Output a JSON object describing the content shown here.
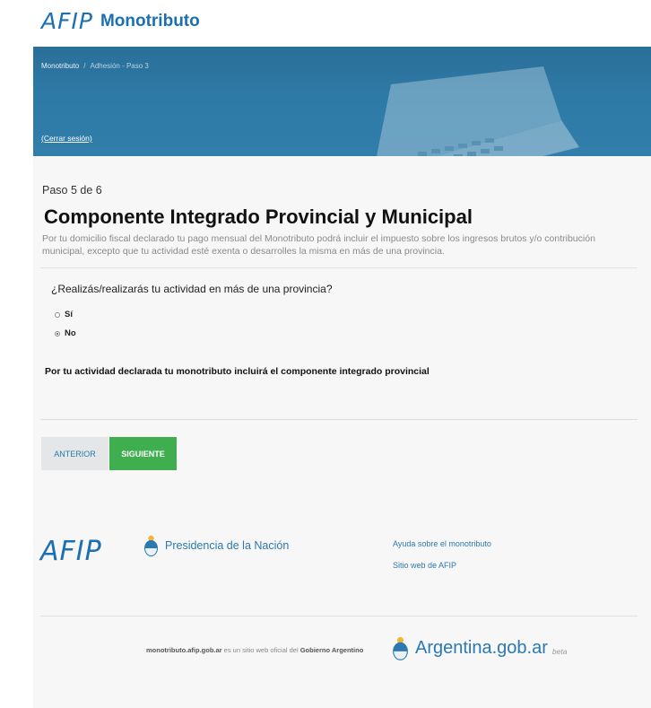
{
  "header": {
    "logo_text": "AFIP",
    "title": "Monotributo"
  },
  "hero": {
    "breadcrumb": [
      "Monotributo",
      "Adhesión - Paso 3"
    ],
    "logout": "(Cerrar sesión)"
  },
  "step": {
    "label": "Paso 5 de 6",
    "title": "Componente Integrado Provincial y Municipal",
    "description": "Por tu domicilio fiscal declarado tu pago mensual del Monotributo podrá incluir el impuesto sobre los ingresos brutos y/o contribución municipal, excepto que tu actividad esté exenta o desarrolles la misma en más de una provincia."
  },
  "form": {
    "question": "¿Realizás/realizarás tu actividad en más de una provincia?",
    "options": [
      {
        "label": "Sí",
        "checked": false
      },
      {
        "label": "No",
        "checked": true
      }
    ],
    "notice": "Por tu actividad declarada tu monotributo incluirá el componente integrado provincial"
  },
  "buttons": {
    "prev": "ANTERIOR",
    "next": "SIGUIENTE"
  },
  "footer": {
    "logo_text": "AFIP",
    "presidencia": "Presidencia de la Nación",
    "links": [
      "Ayuda sobre el monotributo",
      "Sitio web de AFIP"
    ],
    "gov_site": "monotributo.afip.gob.ar",
    "gov_mid": " es un sitio web oficial del ",
    "gov_name": "Gobierno Argentino",
    "argentina": "Argentina.gob.ar",
    "beta": "beta"
  },
  "colors": {
    "brand_blue": "#1c6fb0",
    "link_blue": "#2b79b0",
    "next_green": "#3fae4f",
    "hero_blue": "#2e7aa6"
  },
  "icons": [
    "escudo-icon",
    "radio-icon"
  ]
}
